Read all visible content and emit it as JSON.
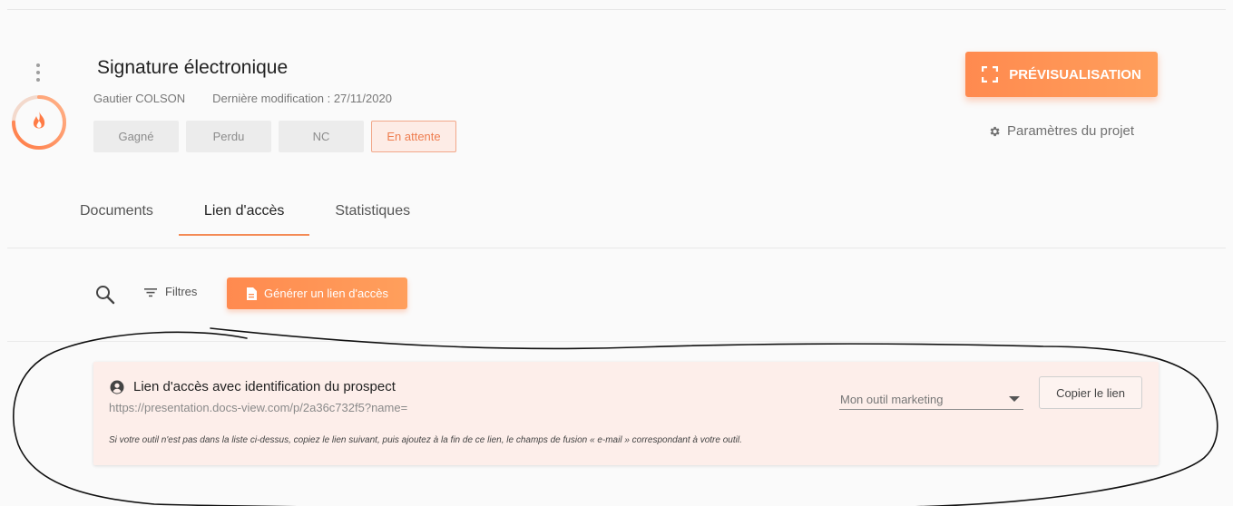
{
  "project": {
    "title": "Signature électronique",
    "owner": "Gautier COLSON",
    "last_modified": "Dernière modification : 27/11/2020",
    "statuses": [
      "Gagné",
      "Perdu",
      "NC",
      "En attente"
    ],
    "active_status": "En attente",
    "temperature_icon": "flame-icon",
    "score_ring_fraction": 0.75
  },
  "actions": {
    "preview_label": "PRÉVISUALISATION",
    "settings_label": "Paramètres du projet"
  },
  "tabs": [
    "Documents",
    "Lien d'accès",
    "Statistiques"
  ],
  "active_tab": "Lien d'accès",
  "toolbar": {
    "filters_label": "Filtres",
    "generate_label": "Générer un lien d'accès"
  },
  "link_card": {
    "title": "Lien d'accès avec identification du prospect",
    "url": "https://presentation.docs-view.com/p/2a36c732f5?name=",
    "note": "Si votre outil n'est pas dans la liste ci-dessus, copiez le lien suivant, puis ajoutez à la fin de ce lien, le champs de fusion « e-mail » correspondant à votre outil.",
    "select_value": "Mon outil marketing",
    "copy_label": "Copier le lien"
  },
  "colors": {
    "accent": "#ff8f52",
    "card_background": "#fdeeea",
    "active_status_background": "#fdece6"
  }
}
